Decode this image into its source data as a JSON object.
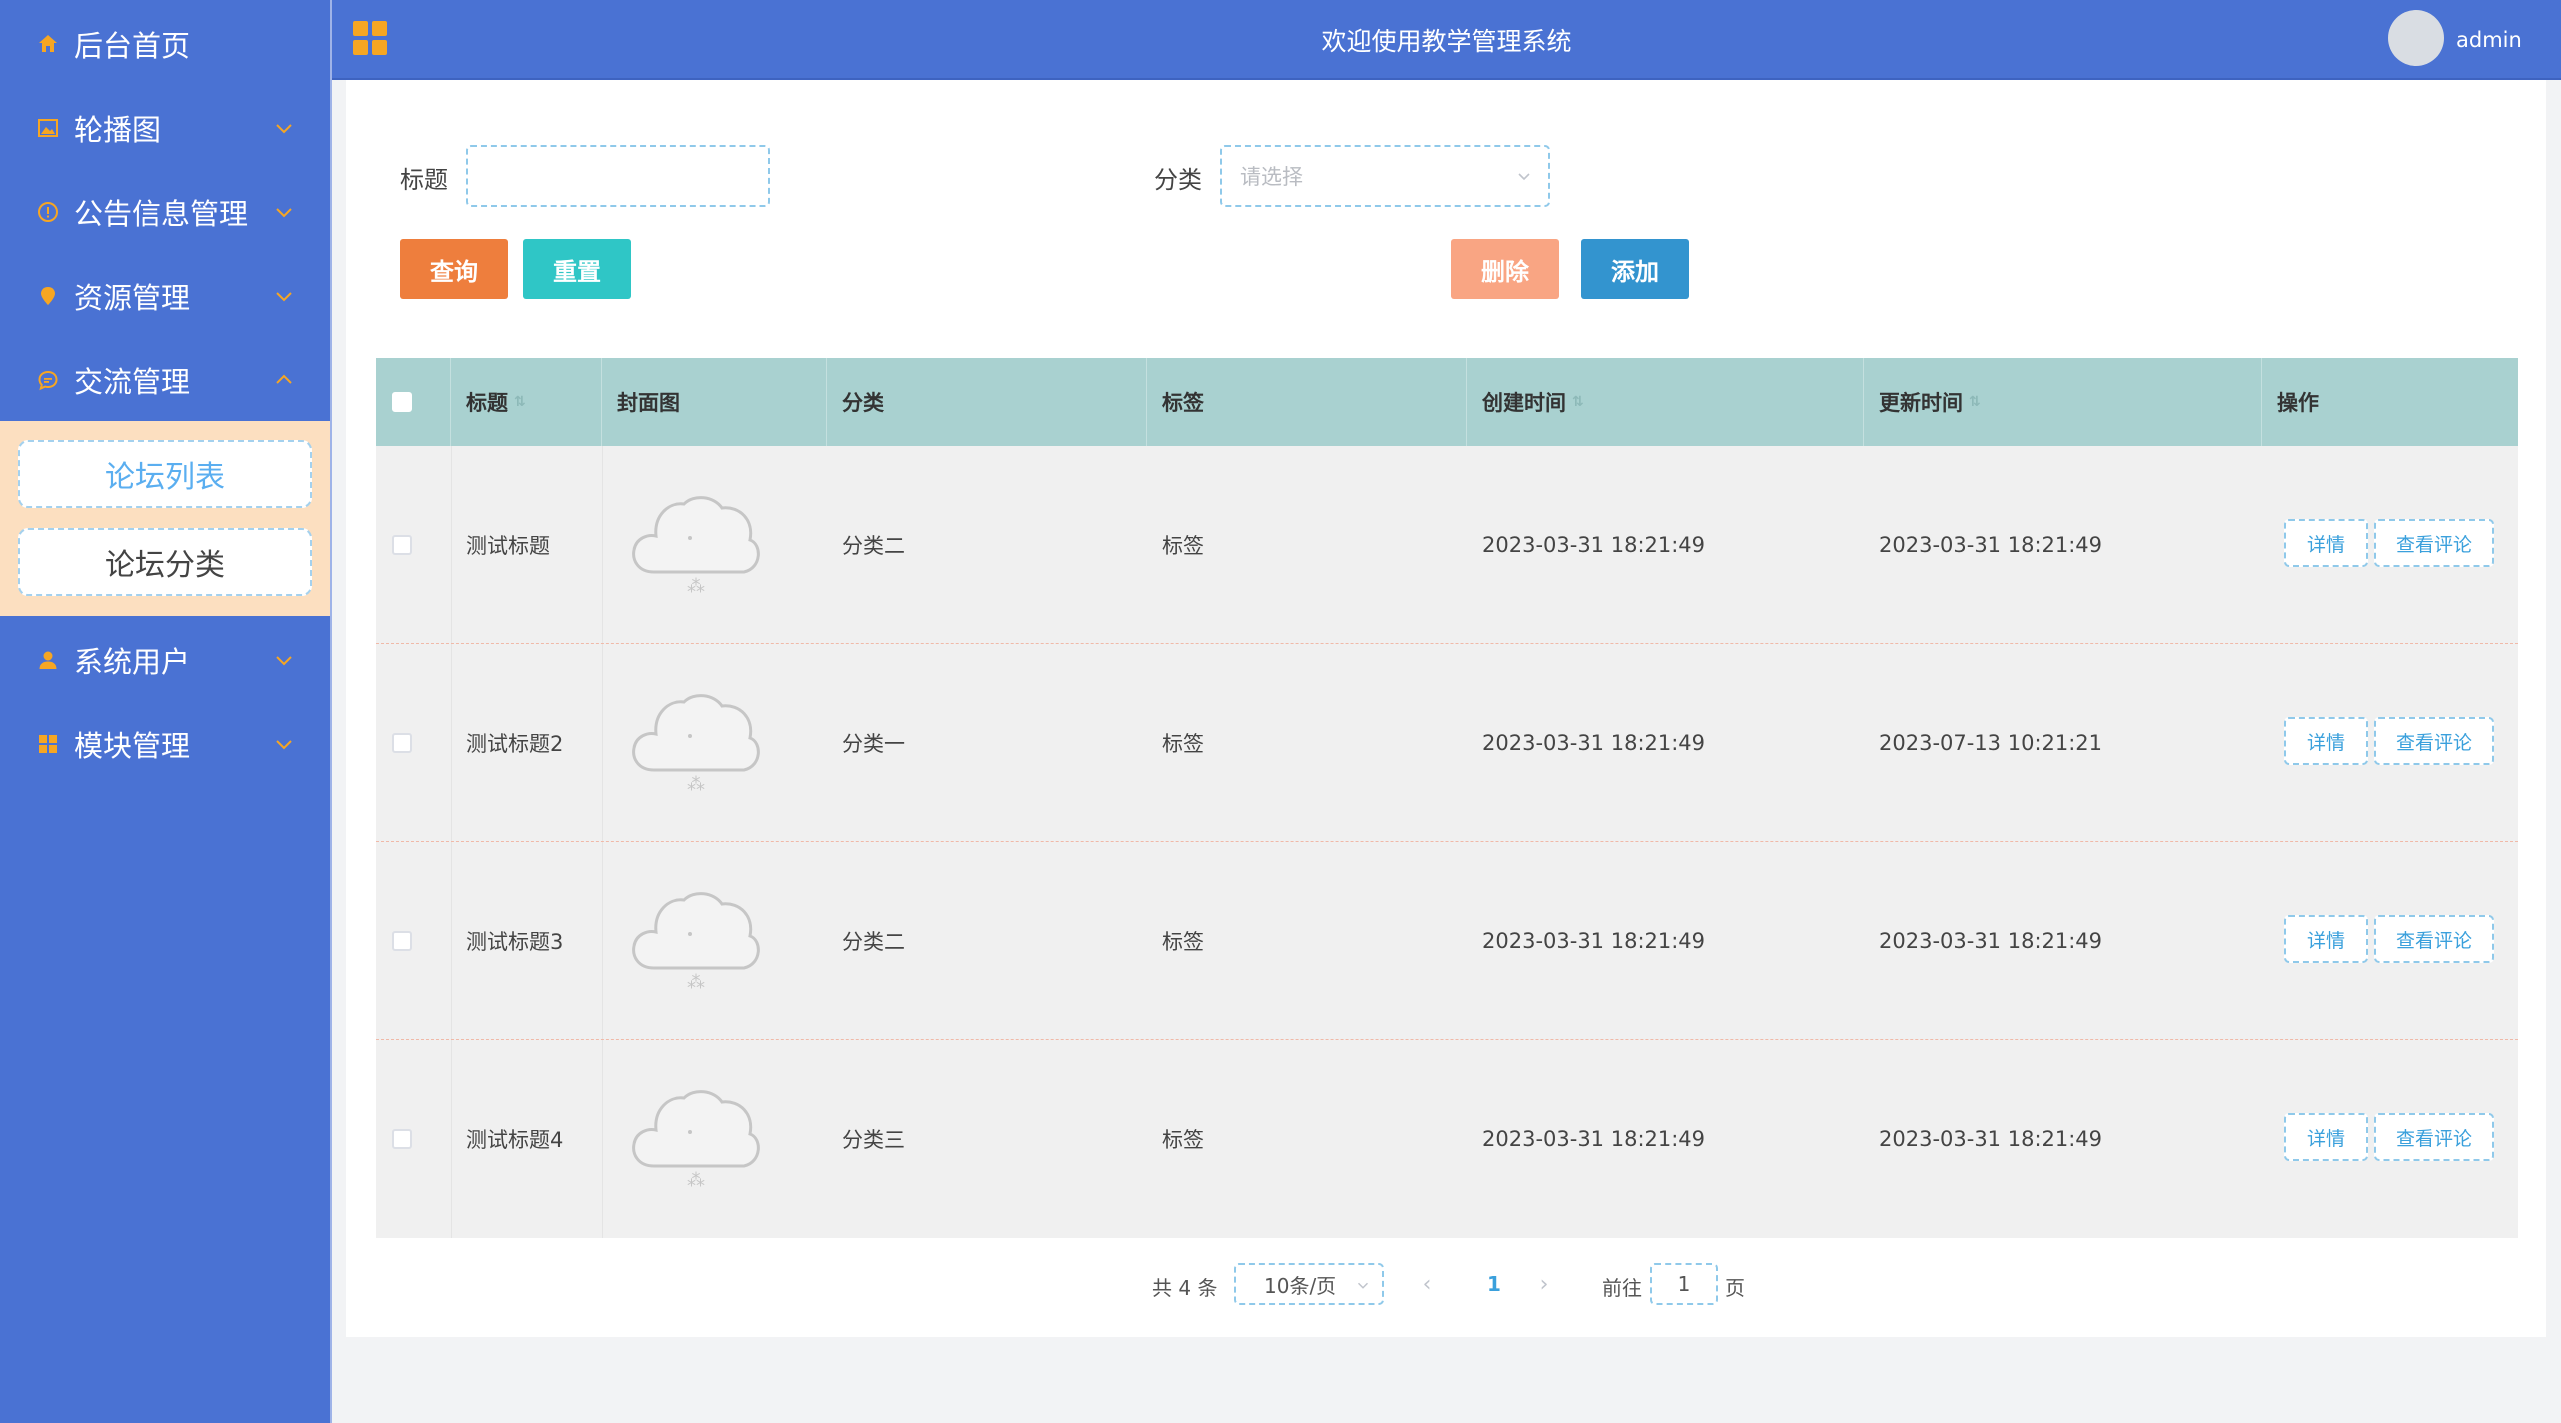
{
  "header": {
    "title": "欢迎使用教学管理系统",
    "username": "admin"
  },
  "sidebar": {
    "items": [
      {
        "label": "后台首页",
        "icon": "home-icon"
      },
      {
        "label": "轮播图",
        "icon": "image-icon"
      },
      {
        "label": "公告信息管理",
        "icon": "info-circle-icon"
      },
      {
        "label": "资源管理",
        "icon": "location-pin-icon"
      },
      {
        "label": "交流管理",
        "icon": "chat-bubble-icon"
      },
      {
        "label": "系统用户",
        "icon": "user-icon"
      },
      {
        "label": "模块管理",
        "icon": "grid-icon"
      }
    ],
    "submenu": [
      "论坛列表",
      "论坛分类"
    ]
  },
  "search": {
    "title_label": "标题",
    "title_value": "",
    "category_label": "分类",
    "category_placeholder": "请选择"
  },
  "buttons": {
    "query": "查询",
    "reset": "重置",
    "delete": "删除",
    "add": "添加"
  },
  "table": {
    "headers": [
      "标题",
      "封面图",
      "分类",
      "标签",
      "创建时间",
      "更新时间",
      "操作"
    ],
    "rows": [
      {
        "title": "测试标题",
        "category": "分类二",
        "tag": "标签",
        "created": "2023-03-31 18:21:49",
        "updated": "2023-03-31 18:21:49"
      },
      {
        "title": "测试标题2",
        "category": "分类一",
        "tag": "标签",
        "created": "2023-03-31 18:21:49",
        "updated": "2023-07-13 10:21:21"
      },
      {
        "title": "测试标题3",
        "category": "分类二",
        "tag": "标签",
        "created": "2023-03-31 18:21:49",
        "updated": "2023-03-31 18:21:49"
      },
      {
        "title": "测试标题4",
        "category": "分类三",
        "tag": "标签",
        "created": "2023-03-31 18:21:49",
        "updated": "2023-03-31 18:21:49"
      }
    ],
    "actions": {
      "detail": "详情",
      "comments": "查看评论"
    }
  },
  "pagination": {
    "total": "共 4 条",
    "page_size": "10条/页",
    "current_page": "1",
    "goto_label": "前往",
    "goto_value": "1",
    "page_suffix": "页"
  },
  "colors": {
    "sidebar": "#4a72d3",
    "header": "#4a72d3",
    "accent_orange": "#f6a623",
    "query_button": "#ee7e3d",
    "reset_button": "#2fc6c6",
    "delete_button": "#f9a583",
    "add_button": "#3394cf",
    "table_header": "#a9d1d0",
    "submenu_bg": "#fcdfc0"
  }
}
